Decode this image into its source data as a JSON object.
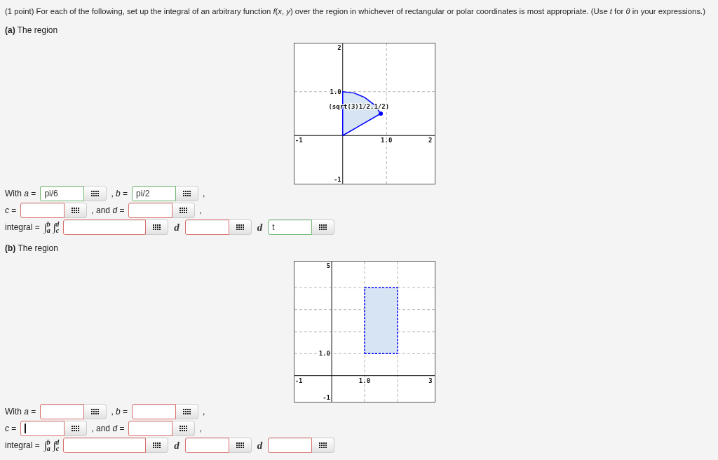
{
  "intro": "(1 point) For each of the following, set up the integral of an arbitrary function *f*(*x*, *y*) over the region in whichever of rectangular or polar coordinates is most appropriate. (Use *t* for *θ* in your expressions.)",
  "parts": [
    {
      "heading": "**(a)** The region",
      "dashed_border": false,
      "chart_data": {
        "type": "area",
        "xlim": [
          -1.1,
          2.1
        ],
        "ylim": [
          -1.1,
          2.1
        ],
        "xticks": [
          {
            "value": -1,
            "label": "-1"
          },
          {
            "value": 1,
            "label": "1.0"
          },
          {
            "value": 2,
            "label": "2"
          }
        ],
        "yticks": [
          {
            "value": -1,
            "label": "-1"
          },
          {
            "value": 1,
            "label": "1.0"
          },
          {
            "value": 2,
            "label": "2"
          }
        ],
        "x": [
          0,
          0,
          0.26,
          0.5,
          0.71,
          0.87,
          0
        ],
        "series": [
          {
            "color": "#0000ff",
            "values": [
              0,
              1,
              0.97,
              0.87,
              0.71,
              0.5,
              0
            ]
          }
        ],
        "annotations": [
          {
            "x": 0.87,
            "y": 0.5,
            "text": "(sqrt(3)1/2,1/2)"
          }
        ]
      },
      "rows": [
        {
          "items": [
            {
              "kind": "text",
              "text": "With *a* ="
            },
            {
              "kind": "field",
              "value": "pi/6",
              "correct": true,
              "focused": false
            },
            {
              "kind": "text",
              "text": ", *b* ="
            },
            {
              "kind": "field",
              "value": "pi/2",
              "correct": true,
              "focused": false
            },
            {
              "kind": "text",
              "text": ","
            }
          ]
        },
        {
          "items": [
            {
              "kind": "text",
              "text": "*c* ="
            },
            {
              "kind": "field",
              "correct": false,
              "focused": false
            },
            {
              "kind": "text",
              "text": ", and *d* ="
            },
            {
              "kind": "field",
              "correct": false,
              "focused": false
            },
            {
              "kind": "text",
              "text": ","
            }
          ]
        },
        {
          "items": [
            {
              "kind": "text",
              "text": "integral ="
            },
            {
              "kind": "integral",
              "text": "∫$_{a}$$^{b}$ ∫$_{c}$$^{d}$"
            },
            {
              "kind": "long_field",
              "correct": false,
              "focused": false
            },
            {
              "kind": "variable",
              "text": "d"
            },
            {
              "kind": "field",
              "correct": false,
              "focused": false
            },
            {
              "kind": "variable",
              "text": "d"
            },
            {
              "kind": "field",
              "value": "t",
              "correct": true,
              "focused": false
            }
          ]
        }
      ]
    },
    {
      "heading": "**(b)** The region",
      "dashed_border": true,
      "chart_data": {
        "type": "area",
        "xlim": [
          -1.13,
          3.13
        ],
        "ylim": [
          -1.19,
          5.19
        ],
        "xticks": [
          {
            "value": -1,
            "label": "-1"
          },
          {
            "value": 1,
            "label": "1.0"
          },
          {
            "value": 3,
            "label": "3"
          }
        ],
        "yticks": [
          {
            "value": -1,
            "label": "-1"
          },
          {
            "value": 1,
            "label": "1.0"
          },
          {
            "value": 5,
            "label": "5"
          }
        ],
        "x": [
          1,
          2,
          2,
          1,
          1
        ],
        "series": [
          {
            "color": "#0000ff",
            "values": [
              1,
              1,
              4,
              4,
              1
            ]
          }
        ]
      },
      "rows": [
        {
          "items": [
            {
              "kind": "text",
              "text": "With *a* ="
            },
            {
              "kind": "field",
              "correct": false,
              "focused": false
            },
            {
              "kind": "text",
              "text": ", *b* ="
            },
            {
              "kind": "field",
              "correct": false,
              "focused": false
            },
            {
              "kind": "text",
              "text": ","
            }
          ]
        },
        {
          "items": [
            {
              "kind": "text",
              "text": "*c* ="
            },
            {
              "kind": "field",
              "correct": false,
              "focused": true
            },
            {
              "kind": "text",
              "text": ", and *d* ="
            },
            {
              "kind": "field",
              "correct": false,
              "focused": false
            },
            {
              "kind": "text",
              "text": ","
            }
          ]
        },
        {
          "items": [
            {
              "kind": "text",
              "text": "integral ="
            },
            {
              "kind": "integral",
              "text": "∫$_{a}$$^{b}$ ∫$_{c}$$^{d}$"
            },
            {
              "kind": "long_field",
              "correct": false,
              "focused": false
            },
            {
              "kind": "variable",
              "text": "d"
            },
            {
              "kind": "field",
              "correct": false,
              "focused": false
            },
            {
              "kind": "variable",
              "text": "d"
            },
            {
              "kind": "field",
              "correct": false,
              "focused": false
            }
          ]
        }
      ]
    }
  ]
}
